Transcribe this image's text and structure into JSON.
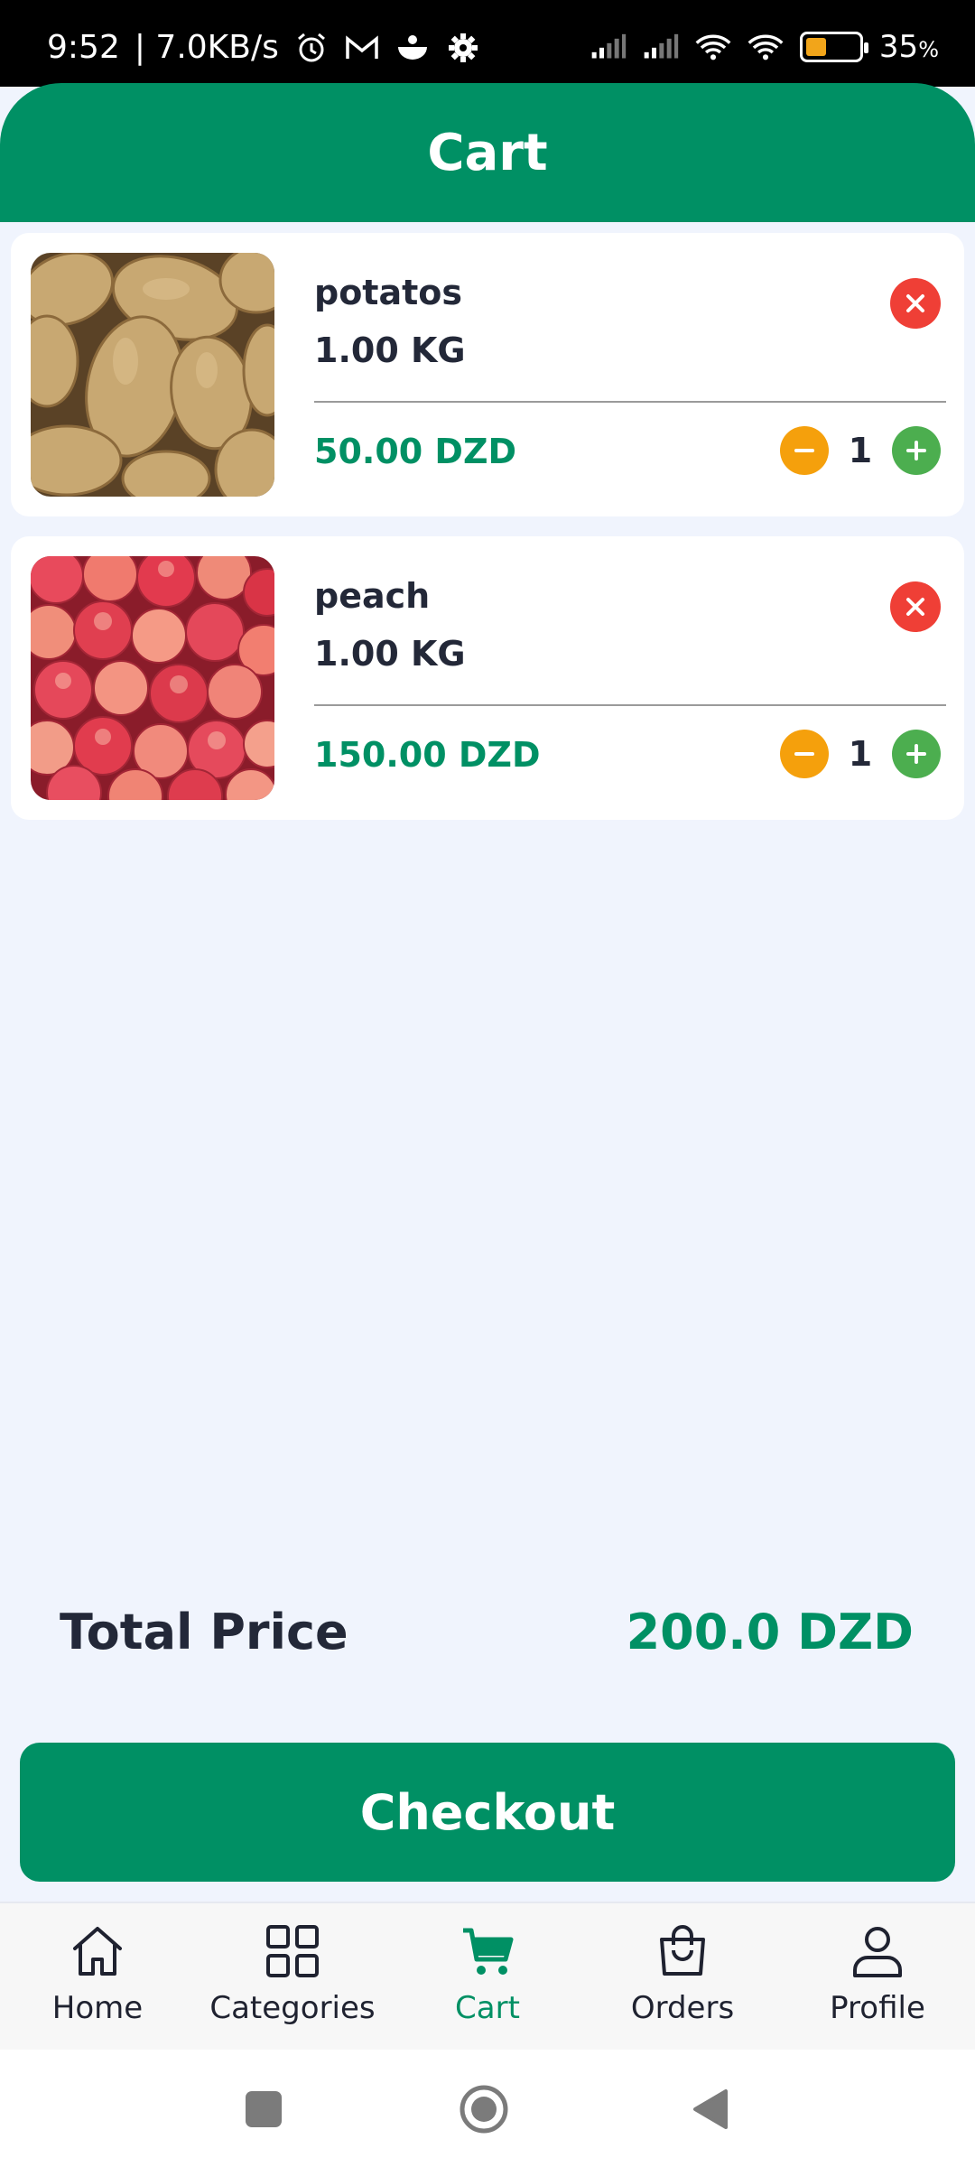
{
  "status_bar": {
    "time": "9:52",
    "speed": "| 7.0KB/s",
    "battery_percent": "35",
    "battery_unit": "%",
    "battery_level": 0.35
  },
  "header": {
    "title": "Cart"
  },
  "cart": {
    "items": [
      {
        "name": "potatos",
        "weight": "1.00 KG",
        "price": "50.00 DZD",
        "quantity": "1",
        "image": "potatoes-photo"
      },
      {
        "name": "peach",
        "weight": "1.00 KG",
        "price": "150.00 DZD",
        "quantity": "1",
        "image": "peaches-photo"
      }
    ]
  },
  "total": {
    "label": "Total Price",
    "value": "200.0 DZD"
  },
  "checkout": {
    "label": "Checkout"
  },
  "bottom_nav": {
    "items": [
      {
        "label": "Home",
        "icon": "home-icon",
        "active": false
      },
      {
        "label": "Categories",
        "icon": "grid-icon",
        "active": false
      },
      {
        "label": "Cart",
        "icon": "cart-icon",
        "active": true
      },
      {
        "label": "Orders",
        "icon": "shopping-bag-icon",
        "active": false
      },
      {
        "label": "Profile",
        "icon": "user-icon",
        "active": false
      }
    ]
  },
  "colors": {
    "primary": "#009064",
    "remove": "#ef3f36",
    "minus": "#f5a00c",
    "plus": "#4cae4f",
    "background": "#f0f4fd"
  }
}
